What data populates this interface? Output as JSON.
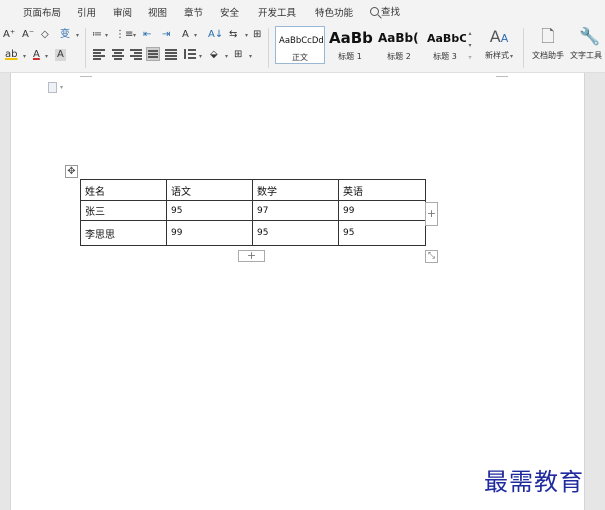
{
  "menu": {
    "tabs": [
      "页面布局",
      "引用",
      "审阅",
      "视图",
      "章节",
      "安全",
      "开发工具",
      "特色功能"
    ],
    "search_label": "查找"
  },
  "ribbon": {
    "font_grow": "A⁺",
    "font_shrink": "A⁻",
    "clear_format": "◇",
    "phonetic": "变",
    "highlight": "ab",
    "font_color": "A",
    "char_shading": "A",
    "bullets": "≔",
    "numbering": "⋮≡",
    "decrease_indent": "⇤",
    "increase_indent": "⇥",
    "text_direction": "A",
    "sort": "A↓",
    "tabs_btn": "⇆",
    "table_btn": "⊞",
    "shading": "⬙",
    "borders": "⊞",
    "styles": [
      {
        "preview": "AaBbCcDd",
        "label": "正文"
      },
      {
        "preview": "AaBb",
        "label": "标题 1"
      },
      {
        "preview": "AaBb(",
        "label": "标题 2"
      },
      {
        "preview": "AaBbC(",
        "label": "标题 3"
      }
    ],
    "new_style_label": "新样式",
    "doc_helper_label": "文档助手",
    "text_tools_label": "文字工具"
  },
  "table": {
    "header": [
      "姓名",
      "语文",
      "数学",
      "英语"
    ],
    "rows": [
      [
        "张三",
        "95",
        "97",
        "99"
      ],
      [
        "李思思",
        "99",
        "95",
        "95"
      ]
    ]
  },
  "table_controls": {
    "add": "+",
    "move": "✥",
    "resize": "⤡"
  },
  "watermark": "最需教育"
}
